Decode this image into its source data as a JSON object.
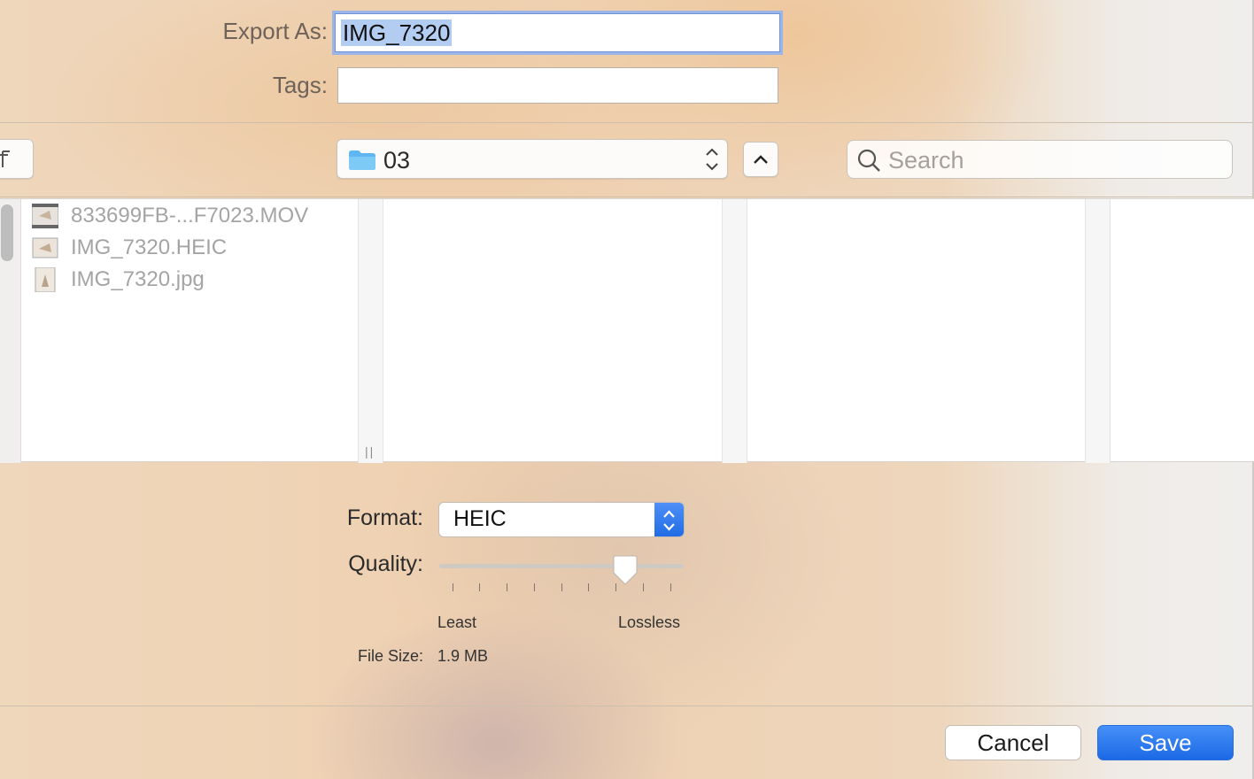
{
  "dialog": {
    "export_label": "Export As:",
    "export_value": "IMG_7320",
    "tags_label": "Tags:",
    "tags_value": ""
  },
  "toolbar": {
    "folder_name": "03",
    "folder_icon": "folder-icon",
    "search_placeholder": "Search"
  },
  "browser": {
    "files": [
      {
        "name": "833699FB-...F7023.MOV",
        "icon": "movie-thumbnail"
      },
      {
        "name": "IMG_7320.HEIC",
        "icon": "image-thumbnail"
      },
      {
        "name": "IMG_7320.jpg",
        "icon": "image-thumbnail"
      }
    ]
  },
  "options": {
    "format_label": "Format:",
    "format_value": "HEIC",
    "quality_label": "Quality:",
    "quality_fraction": 0.76,
    "quality_min_label": "Least",
    "quality_max_label": "Lossless",
    "filesize_label": "File Size:",
    "filesize_value": "1.9 MB"
  },
  "footer": {
    "cancel_label": "Cancel",
    "save_label": "Save"
  },
  "colors": {
    "accent": "#1e6ae3",
    "selection": "#b3cdf2"
  }
}
